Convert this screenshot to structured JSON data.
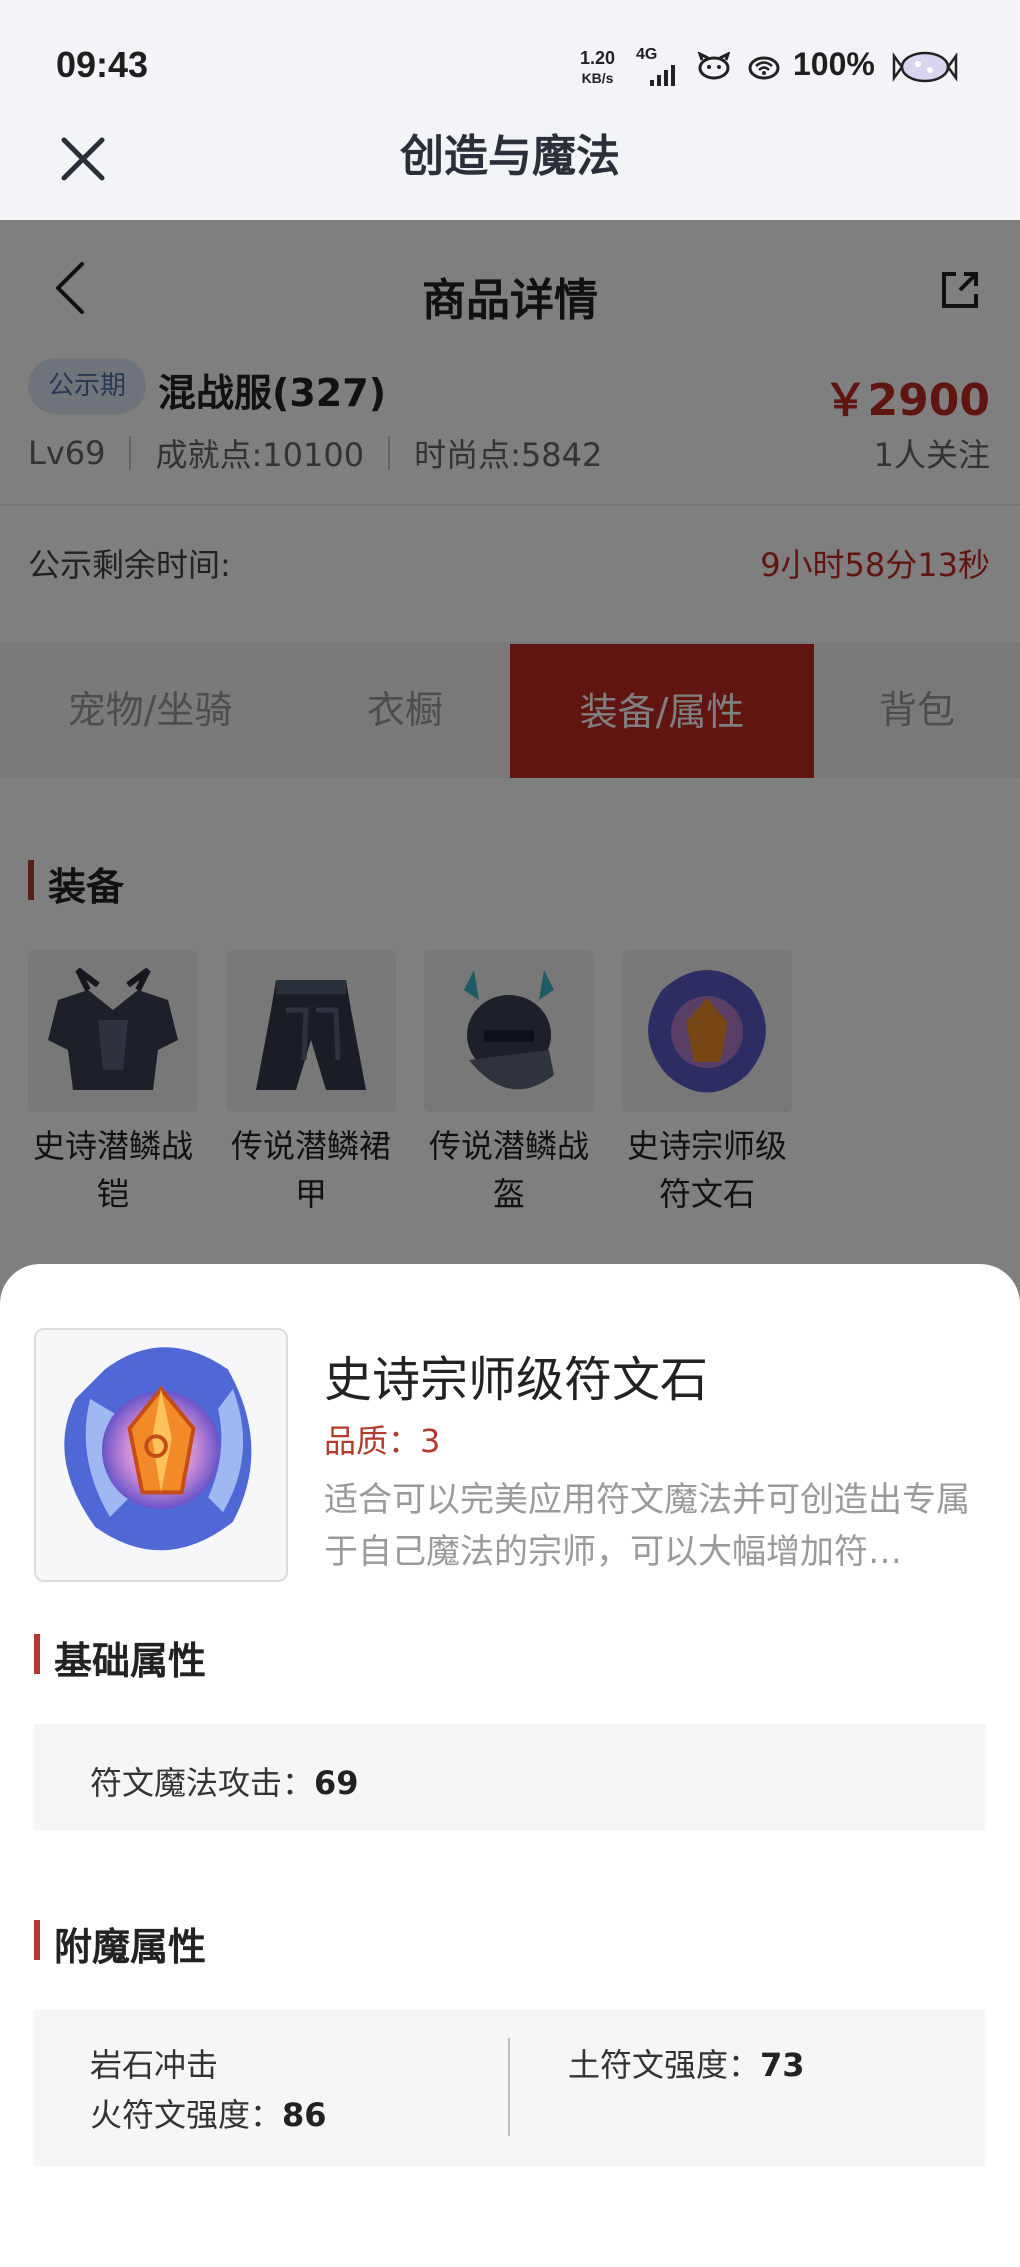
{
  "status_bar": {
    "time": "09:43",
    "net_speed_value": "1.20",
    "net_speed_unit": "KB/s",
    "signal": "4G",
    "battery": "100%"
  },
  "app": {
    "title": "创造与魔法"
  },
  "nav": {
    "title": "商品详情"
  },
  "product": {
    "badge": "公示期",
    "server": "混战服(327)",
    "price": "￥2900",
    "level": "Lv69",
    "achievement": "成就点:10100",
    "fashion": "时尚点:5842",
    "followers": "1人关注"
  },
  "countdown": {
    "label": "公示剩余时间:",
    "value": "9小时58分13秒"
  },
  "tabs": [
    {
      "label": "宠物/坐骑"
    },
    {
      "label": "衣橱"
    },
    {
      "label": "装备/属性"
    },
    {
      "label": "背包"
    }
  ],
  "equipment": {
    "heading": "装备",
    "items": [
      {
        "line1": "史诗潜鳞战",
        "line2": "铠"
      },
      {
        "line1": "传说潜鳞裙",
        "line2": "甲"
      },
      {
        "line1": "传说潜鳞战",
        "line2": "盔"
      },
      {
        "line1": "史诗宗师级",
        "line2": "符文石"
      }
    ]
  },
  "detail": {
    "name": "史诗宗师级符文石",
    "quality": "品质：3",
    "description": "适合可以完美应用符文魔法并可创造出专属于自己魔法的宗师，可以大幅增加符…",
    "base_heading": "基础属性",
    "base_attr": {
      "label": "符文魔法攻击：",
      "value": "69"
    },
    "enchant_heading": "附魔属性",
    "enchant": {
      "skill": "岩石冲击",
      "fire_label": "火符文强度：",
      "fire_value": "86",
      "earth_label": "土符文强度：",
      "earth_value": "73"
    }
  }
}
